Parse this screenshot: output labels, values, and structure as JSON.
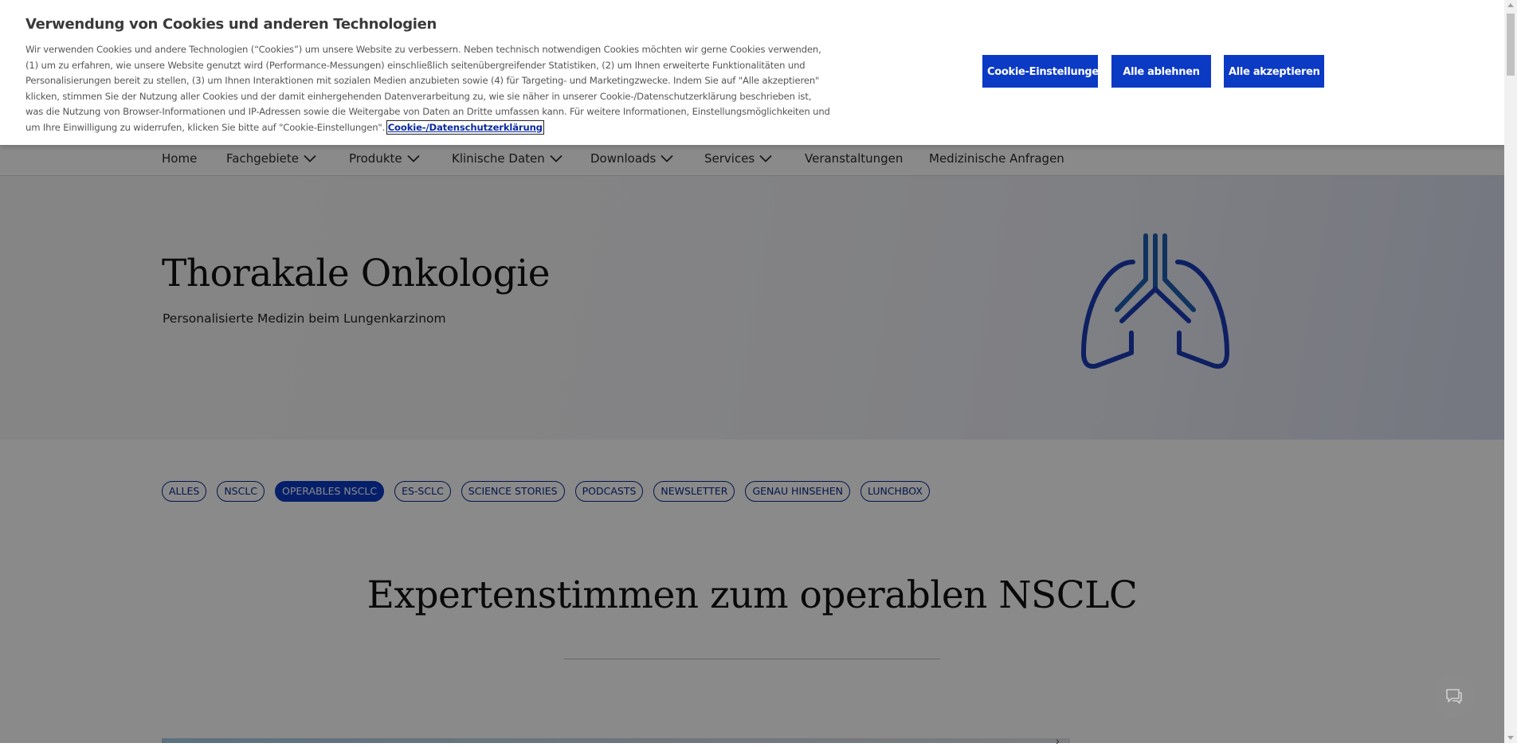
{
  "cookie_banner": {
    "title": "Verwendung von Cookies und anderen Technologien",
    "text": "Wir verwenden Cookies und andere Technologien (“Cookies”) um unsere Website zu verbessern. Neben technisch notwendigen Cookies möchten wir gerne Cookies verwenden, (1) um zu erfahren, wie unsere Website genutzt wird (Performance-Messungen) einschließlich seitenübergreifender Statistiken, (2) um Ihnen erweiterte Funktionalitäten und Personalisierungen bereit zu stellen, (3) um Ihnen Interaktionen mit sozialen Medien anzubieten sowie (4) für Targeting- und Marketingzwecke. Indem Sie auf \"Alle akzeptieren\" klicken, stimmen Sie der Nutzung aller Cookies und der damit einhergehenden Datenverarbeitung zu, wie sie näher in unserer Cookie-/Datenschutzerklärung beschrieben ist, was die Nutzung von Browser-Informationen und IP-Adressen sowie die Weitergabe von Daten an Dritte umfassen kann. Für weitere Informationen, Einstellungsmöglichkeiten und um Ihre Einwilligung zu widerrufen, klicken Sie bitte auf \"Cookie-Einstellungen\".",
    "policy_link": "Cookie-/Datenschutzerklärung",
    "settings_button": "Cookie-Einstellungen",
    "reject_button": "Alle ablehnen",
    "accept_button": "Alle akzeptieren"
  },
  "nav": {
    "items": [
      {
        "label": "Home"
      },
      {
        "label": "Fachgebiete"
      },
      {
        "label": "Produkte"
      },
      {
        "label": "Klinische Daten"
      },
      {
        "label": "Downloads"
      },
      {
        "label": "Services"
      },
      {
        "label": "Veranstaltungen"
      },
      {
        "label": "Medizinische Anfragen"
      }
    ]
  },
  "hero": {
    "title": "Thorakale Onkologie",
    "subtitle": "Personalisierte Medizin beim Lungenkarzinom",
    "icon": "lungs-icon"
  },
  "filters": [
    {
      "label": "ALLES"
    },
    {
      "label": "NSCLC"
    },
    {
      "label": "OPERABLES NSCLC",
      "active": true
    },
    {
      "label": "ES-SCLC"
    },
    {
      "label": "SCIENCE STORIES"
    },
    {
      "label": "PODCASTS"
    },
    {
      "label": "NEWSLETTER"
    },
    {
      "label": "GENAU HINSEHEN"
    },
    {
      "label": "LUNCHBOX"
    }
  ],
  "section": {
    "title": "Expertenstimmen zum operablen NSCLC"
  },
  "colors": {
    "primary": "#0b3ac4",
    "lungs": "#1a3bb5",
    "lungs_inner": "#1f5db0"
  }
}
